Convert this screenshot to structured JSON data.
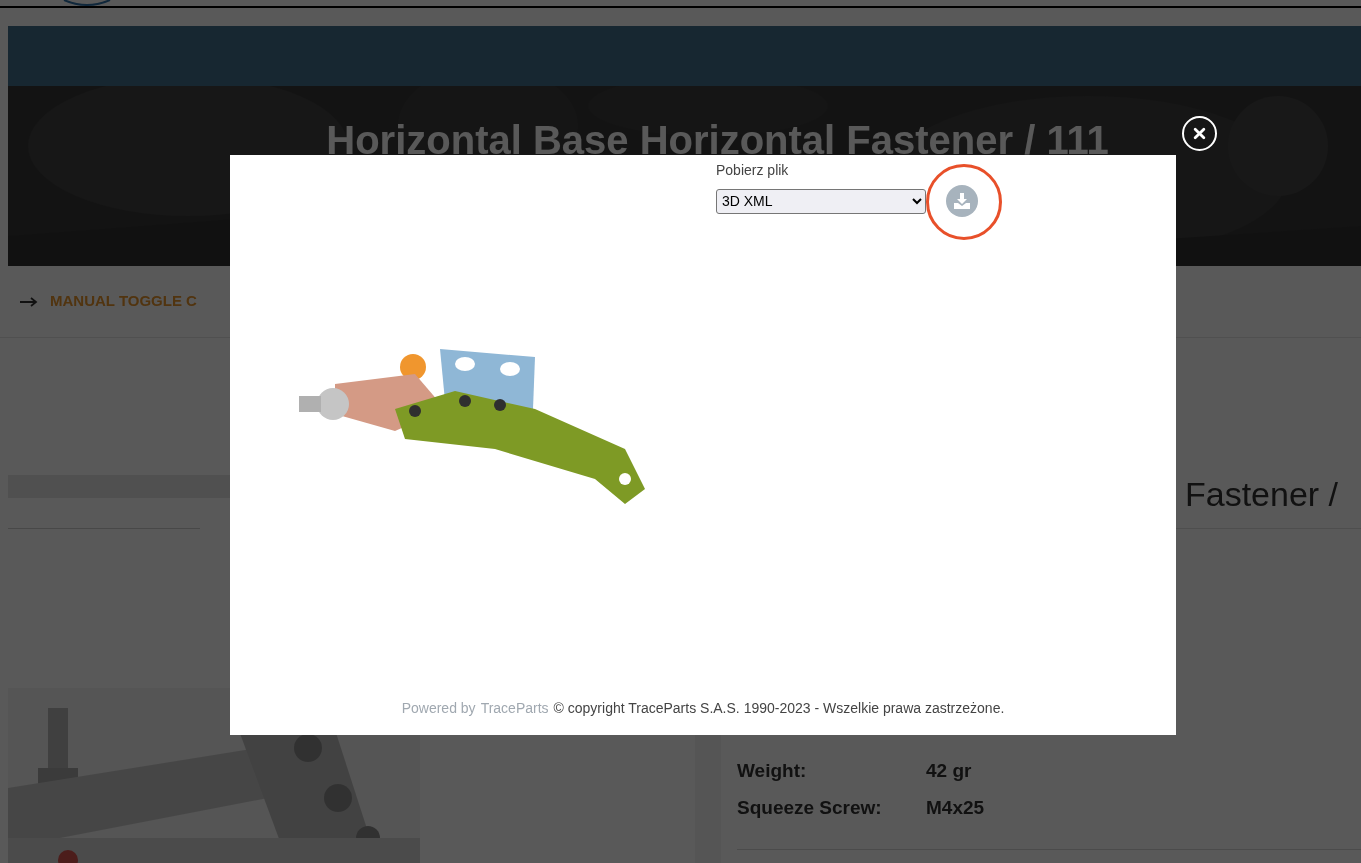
{
  "page": {
    "breadcrumb": "MANUAL TOGGLE C",
    "hero_title": "Horizontal Base Horizontal Fastener / 111",
    "product_heading": "Fastener /",
    "specs": [
      {
        "label": "Weight:",
        "value": "42 gr"
      },
      {
        "label": "Squeeze Screw:",
        "value": "M4x25"
      }
    ]
  },
  "modal": {
    "download_label": "Pobierz plik",
    "format": "3D XML",
    "powered_by": "Powered by",
    "powered_link": "TraceParts",
    "copyright": "© copyright TraceParts S.A.S. 1990-2023 - Wszelkie prawa zastrzeżone."
  }
}
